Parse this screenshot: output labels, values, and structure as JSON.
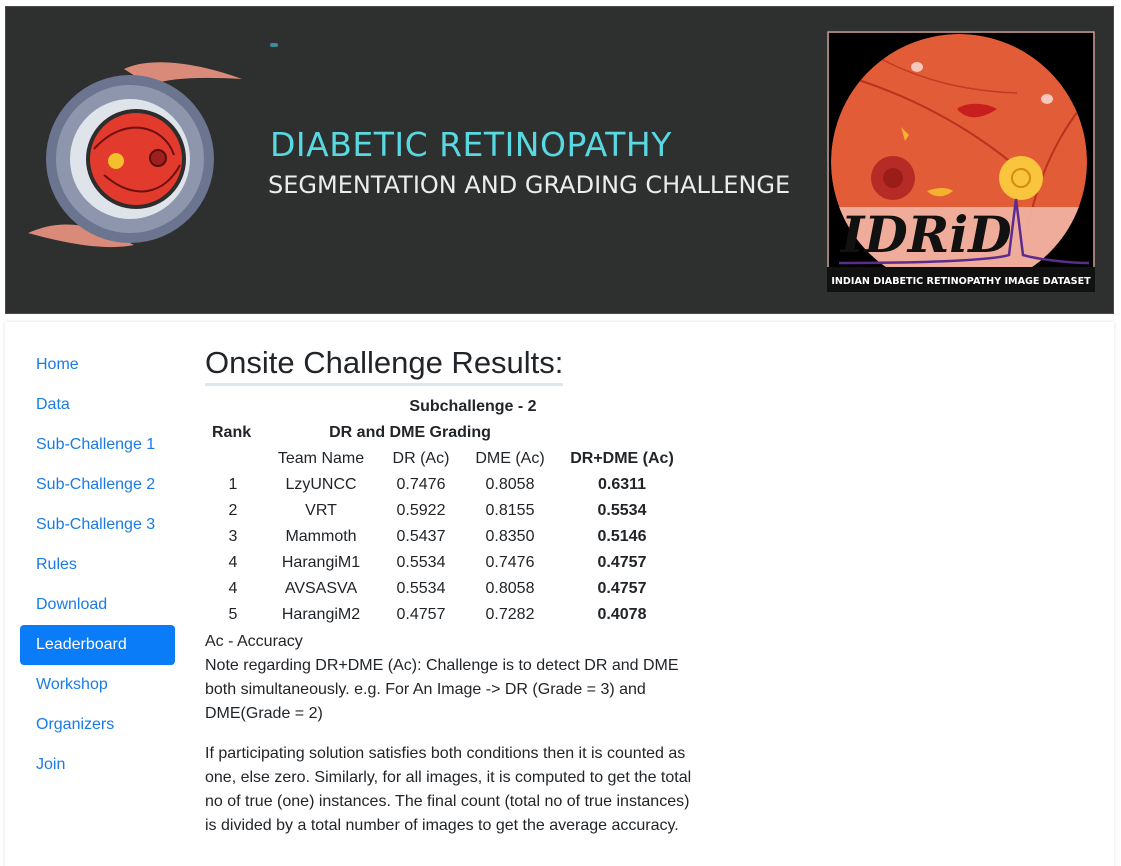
{
  "banner": {
    "title_line1": "DIABETIC RETINOPATHY",
    "title_line2": "SEGMENTATION AND GRADING CHALLENGE",
    "logo_text": "IDRiD",
    "logo_caption": "INDIAN DIABETIC RETINOPATHY IMAGE DATASET"
  },
  "sidebar": {
    "items": [
      {
        "label": "Home",
        "active": false
      },
      {
        "label": "Data",
        "active": false
      },
      {
        "label": "Sub-Challenge 1",
        "active": false
      },
      {
        "label": "Sub-Challenge 2",
        "active": false
      },
      {
        "label": "Sub-Challenge 3",
        "active": false
      },
      {
        "label": "Rules",
        "active": false
      },
      {
        "label": "Download",
        "active": false
      },
      {
        "label": "Leaderboard",
        "active": true
      },
      {
        "label": "Workshop",
        "active": false
      },
      {
        "label": "Organizers",
        "active": false
      },
      {
        "label": "Join",
        "active": false
      }
    ]
  },
  "main": {
    "title": "Onsite Challenge Results:",
    "table": {
      "subchallenge": "Subchallenge - 2",
      "rank_header": "Rank",
      "group_header": "DR and DME Grading",
      "columns": [
        "Team Name",
        "DR (Ac)",
        "DME (Ac)",
        "DR+DME (Ac)"
      ],
      "rows": [
        {
          "rank": "1",
          "team": "LzyUNCC",
          "dr": "0.7476",
          "dme": "0.8058",
          "both": "0.6311"
        },
        {
          "rank": "2",
          "team": "VRT",
          "dr": "0.5922",
          "dme": "0.8155",
          "both": "0.5534"
        },
        {
          "rank": "3",
          "team": "Mammoth",
          "dr": "0.5437",
          "dme": "0.8350",
          "both": "0.5146"
        },
        {
          "rank": "4",
          "team": "HarangiM1",
          "dr": "0.5534",
          "dme": "0.7476",
          "both": "0.4757"
        },
        {
          "rank": "4",
          "team": "AVSASVA",
          "dr": "0.5534",
          "dme": "0.8058",
          "both": "0.4757"
        },
        {
          "rank": "5",
          "team": "HarangiM2",
          "dr": "0.4757",
          "dme": "0.7282",
          "both": "0.4078"
        }
      ]
    },
    "legend": "Ac - Accuracy",
    "note1": "Note regarding DR+DME (Ac): Challenge is to detect DR and DME both simultaneously. e.g. For An Image -> DR (Grade = 3) and DME(Grade = 2)",
    "note2": "If participating solution satisfies both conditions then it is counted as one, else zero. Similarly, for all images, it is computed to get the total no of true (one) instances. The final count (total no of true instances) is divided by a total number of images to get the average accuracy."
  },
  "colors": {
    "banner_bg": "#2e2f2f",
    "title_cyan": "#58d8e0",
    "link_blue": "#1a7be6",
    "active_bg": "#0a7cf7"
  }
}
